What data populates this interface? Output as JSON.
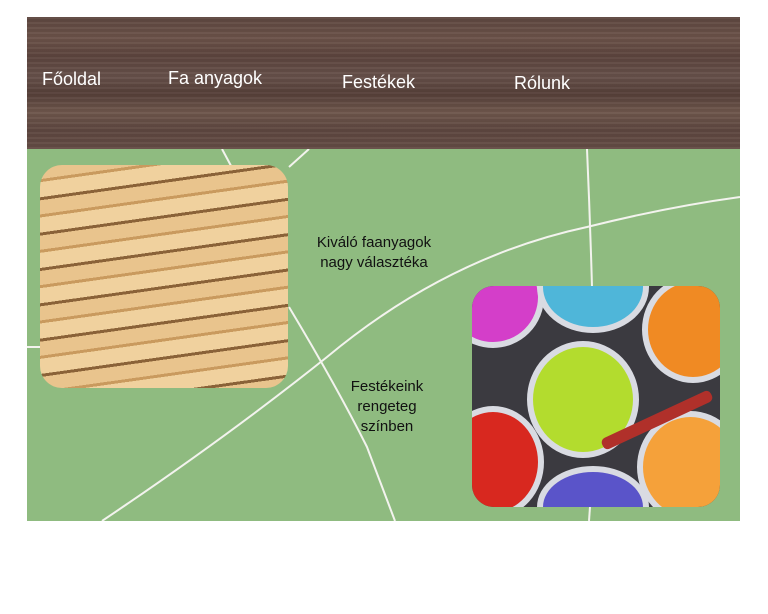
{
  "nav": {
    "items": [
      {
        "label": "Főoldal"
      },
      {
        "label": "Fa anyagok"
      },
      {
        "label": "Festékek"
      },
      {
        "label": "Rólunk"
      }
    ]
  },
  "sections": {
    "wood_caption_line1": "Kiváló faanyagok",
    "wood_caption_line2": "nagy választéka",
    "paint_caption_line1": "Festékeink",
    "paint_caption_line2": "rengeteg",
    "paint_caption_line3": "színben"
  },
  "colors": {
    "background": "#8fbb80",
    "header": "#5f4740"
  }
}
